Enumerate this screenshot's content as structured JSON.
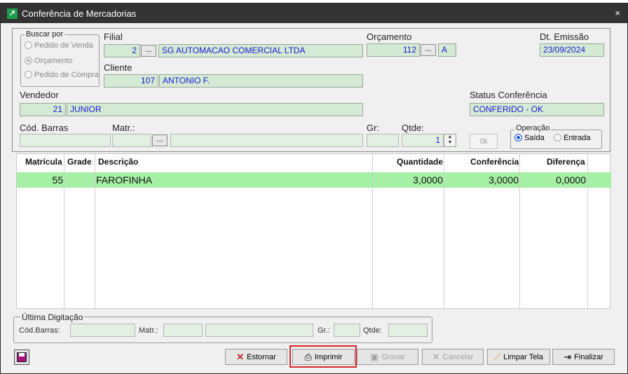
{
  "window": {
    "title": "Conferência de Mercadorias",
    "close_glyph": "×",
    "app_icon": "↗"
  },
  "search_by": {
    "legend": "Buscar por",
    "options": [
      {
        "label": "Pedido de Venda",
        "selected": false
      },
      {
        "label": "Orçamento",
        "selected": true
      },
      {
        "label": "Pedido de Compra",
        "selected": false
      }
    ]
  },
  "filial": {
    "label": "Filial",
    "code": "2",
    "name": "SG AUTOMACAO COMERCIAL LTDA"
  },
  "orcamento": {
    "label": "Orçamento",
    "number": "112",
    "letter": "A"
  },
  "emissao": {
    "label": "Dt. Emissão",
    "value": "23/09/2024"
  },
  "cliente": {
    "label": "Cliente",
    "code": "107",
    "name": "ANTONIO F."
  },
  "vendedor": {
    "label": "Vendedor",
    "code": "21",
    "name": "JUNIOR"
  },
  "status": {
    "label": "Status Conferência",
    "value": "CONFERIDO - OK"
  },
  "entry": {
    "cod_barras_label": "Cód. Barras",
    "matr_label": "Matr.:",
    "gr_label": "Gr:",
    "qtde_label": "Qtde:",
    "qtde_value": "1",
    "ok_label": "0k"
  },
  "operacao": {
    "legend": "Operação",
    "saida": "Saída",
    "entrada": "Entrada",
    "selected": "saida"
  },
  "grid": {
    "columns": [
      "Matrícula",
      "Grade",
      "Descrição",
      "Quantidade",
      "Conferência",
      "Diferença"
    ],
    "rows": [
      {
        "matricula": "55",
        "grade": "",
        "descricao": "FAROFINHA",
        "quantidade": "3,0000",
        "conferencia": "3,0000",
        "diferenca": "0,0000"
      }
    ]
  },
  "ultima": {
    "legend": "Última Digitação",
    "cod_label": "Cód.Barras:",
    "matr_label": "Matr.:",
    "gr_label": "Gr.:",
    "qtde_label": "Qtde:"
  },
  "buttons": {
    "estornar": "Estornar",
    "imprimir": "Imprimir",
    "gravar": "Gravar",
    "cancelar": "Cancelar",
    "limpar": "Limpar Tela",
    "finalizar": "Finalizar"
  },
  "colors": {
    "titlebar": "#333333",
    "field_bg": "#d4ead4",
    "field_text": "#1a1ad0",
    "row_highlight": "#a5f0a5",
    "focus_border": "#d9242a"
  }
}
